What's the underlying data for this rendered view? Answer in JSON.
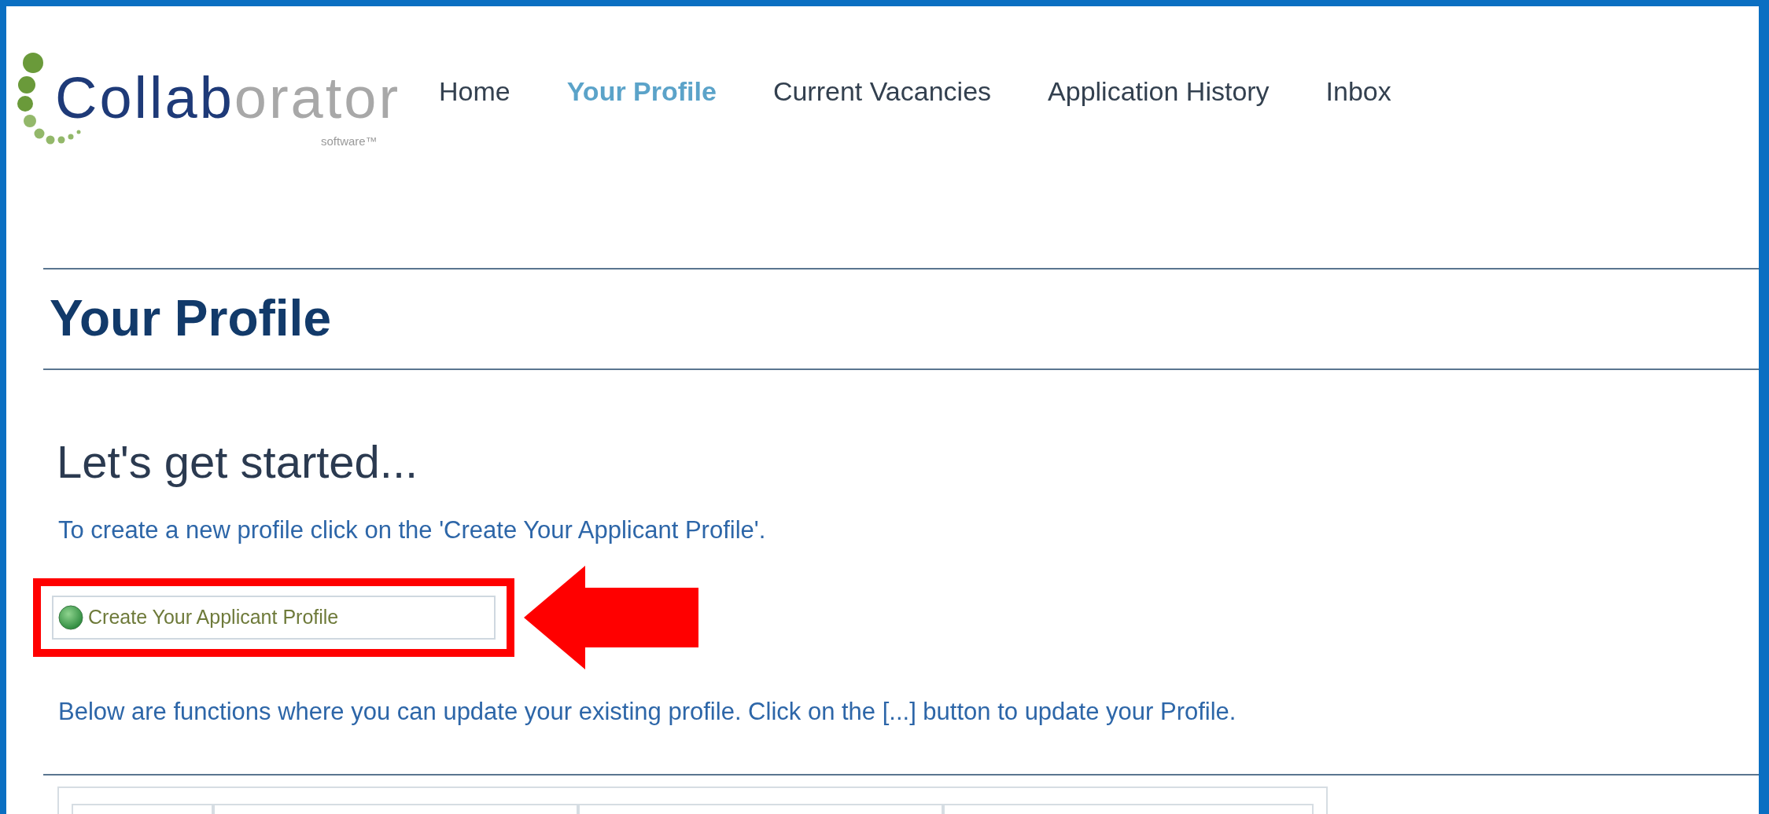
{
  "logo": {
    "primary": "Collab",
    "secondary": "orator",
    "tagline": "software™"
  },
  "nav": [
    {
      "label": "Home",
      "selected": false
    },
    {
      "label": "Your Profile",
      "selected": true
    },
    {
      "label": "Current Vacancies",
      "selected": false
    },
    {
      "label": "Application History",
      "selected": false
    },
    {
      "label": "Inbox",
      "selected": false
    }
  ],
  "page_title": "Your Profile",
  "section_title": "Let's get started...",
  "intro": "To create a new profile click on the 'Create Your Applicant Profile'.",
  "create_button": {
    "label": "Create Your Applicant Profile"
  },
  "functions_text": "Below are functions where you can update your existing profile. Click on the [...] button to update your Profile."
}
